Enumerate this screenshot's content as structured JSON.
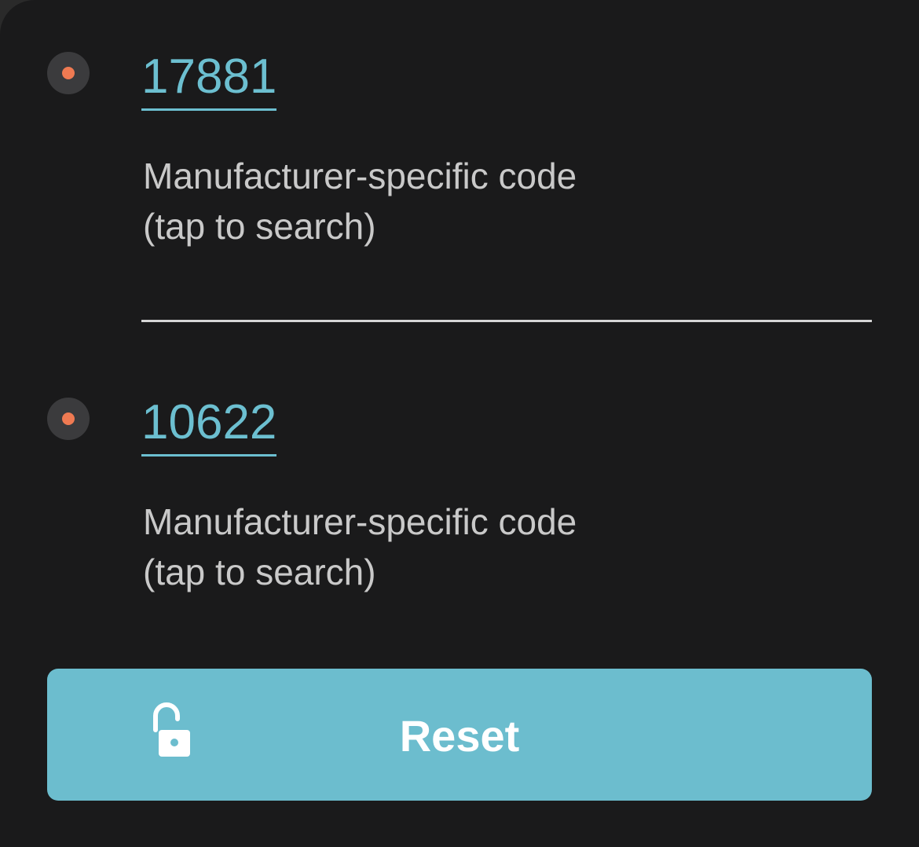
{
  "codes": [
    {
      "code": "17881",
      "description_line1": "Manufacturer-specific code",
      "description_line2": "(tap to search)",
      "status_color": "#ef7a52"
    },
    {
      "code": "10622",
      "description_line1": "Manufacturer-specific code",
      "description_line2": "(tap to search)",
      "status_color": "#ef7a52"
    }
  ],
  "reset_button": {
    "label": "Reset",
    "icon": "unlock-icon",
    "color": "#6cbdce"
  },
  "theme": {
    "background": "#1a1a1b",
    "accent": "#6cbfd0",
    "text": "#c9c9c9"
  }
}
